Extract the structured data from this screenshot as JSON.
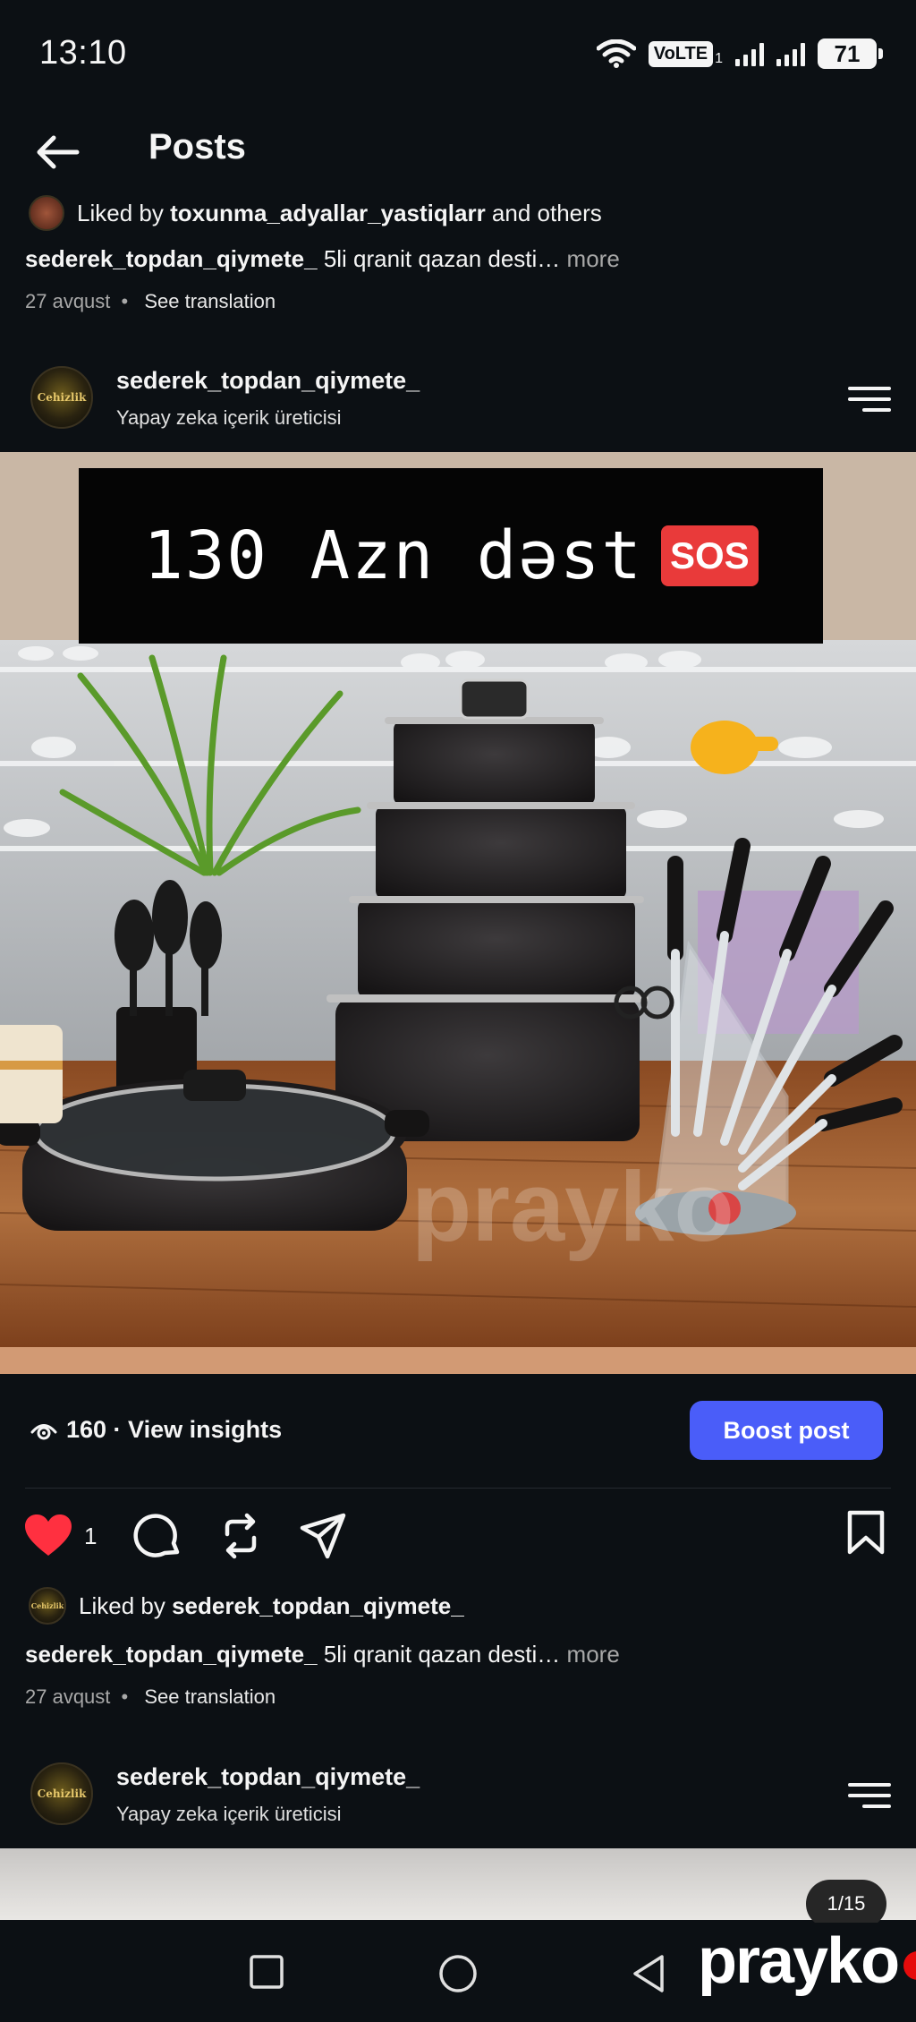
{
  "status_bar": {
    "time": "13:10",
    "volte": "VoLTE",
    "sim_index": "1",
    "battery": "71"
  },
  "header": {
    "title": "Posts"
  },
  "prev_post": {
    "liked_prefix": "Liked by ",
    "liked_user": "toxunma_adyallar_yastiqlarr",
    "liked_suffix": " and others",
    "caption_user": "sederek_topdan_qiymete_",
    "caption_text": " 5li qranit qazan desti…",
    "more": " more",
    "date": "27 avqust",
    "sep": "•",
    "translate": "See translation"
  },
  "post": {
    "account_name": "sederek_topdan_qiymete_",
    "account_subtitle": "Yapay zeka içerik üreticisi",
    "avatar_text": "Cehizlik",
    "image": {
      "banner_text": "130 Azn dəst",
      "sos_badge": "SOS",
      "watermark": "prayko"
    },
    "insights": "160 · View insights",
    "boost_label": "Boost post",
    "like_count": "1",
    "liked_prefix": "Liked by ",
    "liked_user": "sederek_topdan_qiymete_",
    "caption_user": "sederek_topdan_qiymete_",
    "caption_text": " 5li qranit qazan desti…",
    "more": " more",
    "date": "27 avqust",
    "sep": "•",
    "translate": "See translation"
  },
  "next_post": {
    "account_name": "sederek_topdan_qiymete_",
    "account_subtitle": "Yapay zeka içerik üreticisi",
    "avatar_text": "Cehizlik",
    "pager": "1/15"
  },
  "footer": {
    "watermark_brand": "prayko"
  },
  "colors": {
    "background": "#0c1014",
    "boost_button": "#4a5df9",
    "like_heart": "#ff3040",
    "sos_badge": "#e93a3a"
  }
}
